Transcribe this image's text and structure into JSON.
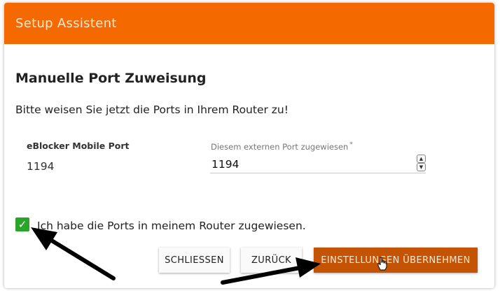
{
  "header": {
    "title": "Setup Assistent"
  },
  "main": {
    "section_title": "Manuelle Port Zuweisung",
    "instruction": "Bitte weisen Sie jetzt die Ports in Ihrem Router zu!",
    "port_row": {
      "label": "eBlocker Mobile Port",
      "value": "1194",
      "input_label": "Diesem externen Port zugewiesen",
      "required_mark": "*",
      "input_value": "1194"
    },
    "confirm": {
      "checked": true,
      "label": "Ich habe die Ports in meinem Router zugewiesen."
    }
  },
  "buttons": {
    "close": "SCHLIESSEN",
    "back": "ZURÜCK",
    "apply": "EINSTELLUNGEN ÜBERNEHMEN"
  },
  "colors": {
    "header_bg": "#f46a00",
    "primary_button_bg": "#c45404",
    "checkbox_bg": "#2aa52a"
  },
  "icons": {
    "check": "check-icon",
    "spin_up": "chevron-up-icon",
    "spin_down": "chevron-down-icon",
    "cursor": "hand-pointer-icon",
    "annotation_arrows": "arrow-icon"
  }
}
